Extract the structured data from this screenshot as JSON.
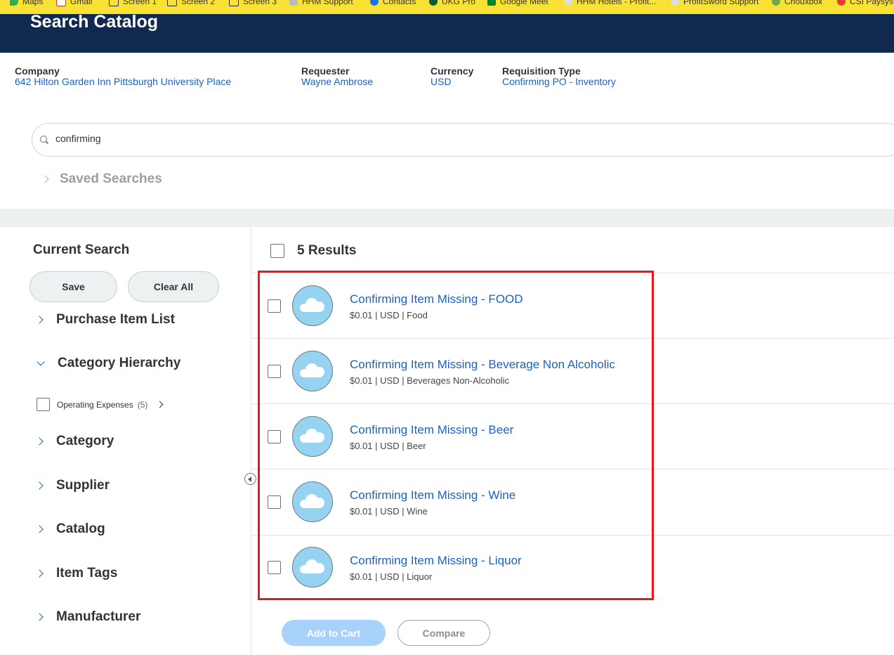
{
  "bookmarks": [
    {
      "label": "Maps",
      "icon": "maps-icon",
      "color": "#34a853"
    },
    {
      "label": "Gmail",
      "icon": "gmail-icon",
      "color": "#ffffff"
    },
    {
      "label": "Screen 1",
      "icon": "folder-icon",
      "color": "#f9e233"
    },
    {
      "label": "Screen 2",
      "icon": "folder-icon",
      "color": "#f9e233"
    },
    {
      "label": "Screen 3",
      "icon": "folder-icon",
      "color": "#f9e233"
    },
    {
      "label": "HHM Support",
      "icon": "hhm-icon",
      "color": "#bbbbbb"
    },
    {
      "label": "Contacts",
      "icon": "contacts-icon",
      "color": "#1a73e8"
    },
    {
      "label": "UKG Pro",
      "icon": "ukg-icon",
      "color": "#0b5c3a"
    },
    {
      "label": "Google Meet",
      "icon": "meet-icon",
      "color": "#00832d"
    },
    {
      "label": "HHM Hotels - Profit...",
      "icon": "hhm-hotels-icon",
      "color": "#dddddd"
    },
    {
      "label": "ProfitSword Support",
      "icon": "profitsword-icon",
      "color": "#dddddd"
    },
    {
      "label": "Chouxbox",
      "icon": "chouxbox-icon",
      "color": "#6aa84f"
    },
    {
      "label": "CSI Paysyste",
      "icon": "csi-icon",
      "color": "#e53935"
    }
  ],
  "header": {
    "title": "Search Catalog"
  },
  "info": {
    "company": {
      "label": "Company",
      "value": "642 Hilton Garden Inn Pittsburgh University Place"
    },
    "requester": {
      "label": "Requester",
      "value": "Wayne Ambrose"
    },
    "currency": {
      "label": "Currency",
      "value": "USD"
    },
    "requisition_type": {
      "label": "Requisition Type",
      "value": "Confirming PO - Inventory"
    }
  },
  "search": {
    "value": "confirming"
  },
  "saved_searches": "Saved Searches",
  "sidebar": {
    "title": "Current Search",
    "save_label": "Save",
    "clear_label": "Clear All",
    "facets": {
      "purchase_item_list": "Purchase Item List",
      "category_hierarchy": "Category Hierarchy",
      "category": "Category",
      "supplier": "Supplier",
      "catalog": "Catalog",
      "item_tags": "Item Tags",
      "manufacturer": "Manufacturer"
    },
    "category_option": {
      "label": "Operating Expenses",
      "count": "(5)"
    }
  },
  "results": {
    "count_label": "5 Results",
    "items": [
      {
        "name": "Confirming Item Missing - FOOD",
        "meta": "$0.01 | USD | Food"
      },
      {
        "name": "Confirming Item Missing - Beverage Non Alcoholic",
        "meta": "$0.01 | USD | Beverages Non-Alcoholic"
      },
      {
        "name": "Confirming Item Missing - Beer",
        "meta": "$0.01 | USD | Beer"
      },
      {
        "name": "Confirming Item Missing - Wine",
        "meta": "$0.01 | USD | Wine"
      },
      {
        "name": "Confirming Item Missing - Liquor",
        "meta": "$0.01 | USD | Liquor"
      }
    ]
  },
  "footer": {
    "add_to_cart": "Add to Cart",
    "compare": "Compare"
  },
  "colors": {
    "header": "#102a4f",
    "link": "#1b62c2",
    "highlight": "#f21515",
    "thumb": "#95d3f0"
  }
}
